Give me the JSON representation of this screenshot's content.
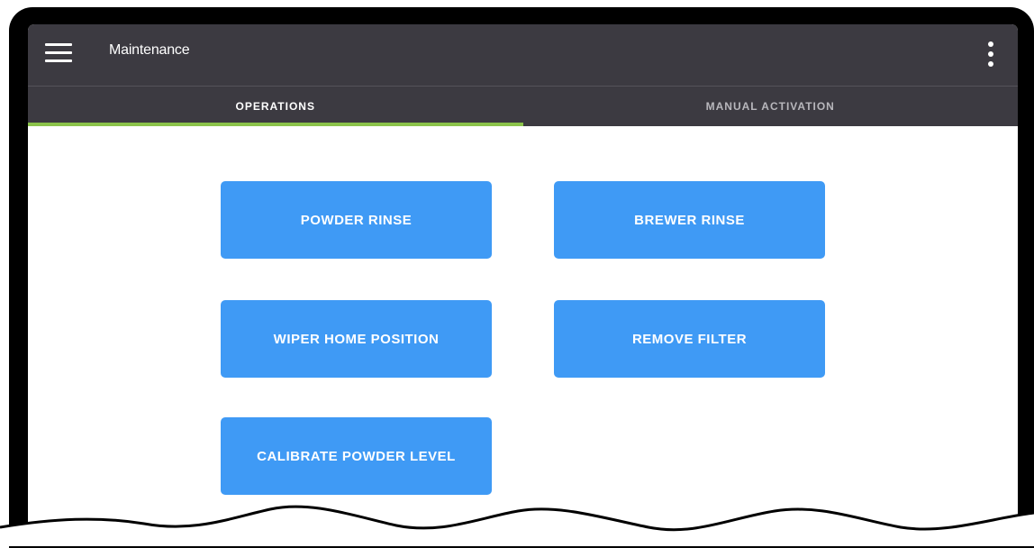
{
  "appbar": {
    "title": "Maintenance",
    "menu_icon": "hamburger-menu-icon",
    "more_icon": "more-vert-icon"
  },
  "tabs": [
    {
      "label": "OPERATIONS",
      "active": true
    },
    {
      "label": "MANUAL ACTIVATION",
      "active": false
    }
  ],
  "operations": {
    "powder_rinse": "POWDER RINSE",
    "brewer_rinse": "BREWER RINSE",
    "wiper_home_position": "WIPER HOME POSITION",
    "remove_filter": "REMOVE FILTER",
    "calibrate_powder_level": "CALIBRATE POWDER LEVEL"
  },
  "colors": {
    "appbar": "#3c3a41",
    "tab_indicator": "#8bc34a",
    "button": "#3f9af5",
    "inactive_tab_text": "#b8b7bc"
  }
}
